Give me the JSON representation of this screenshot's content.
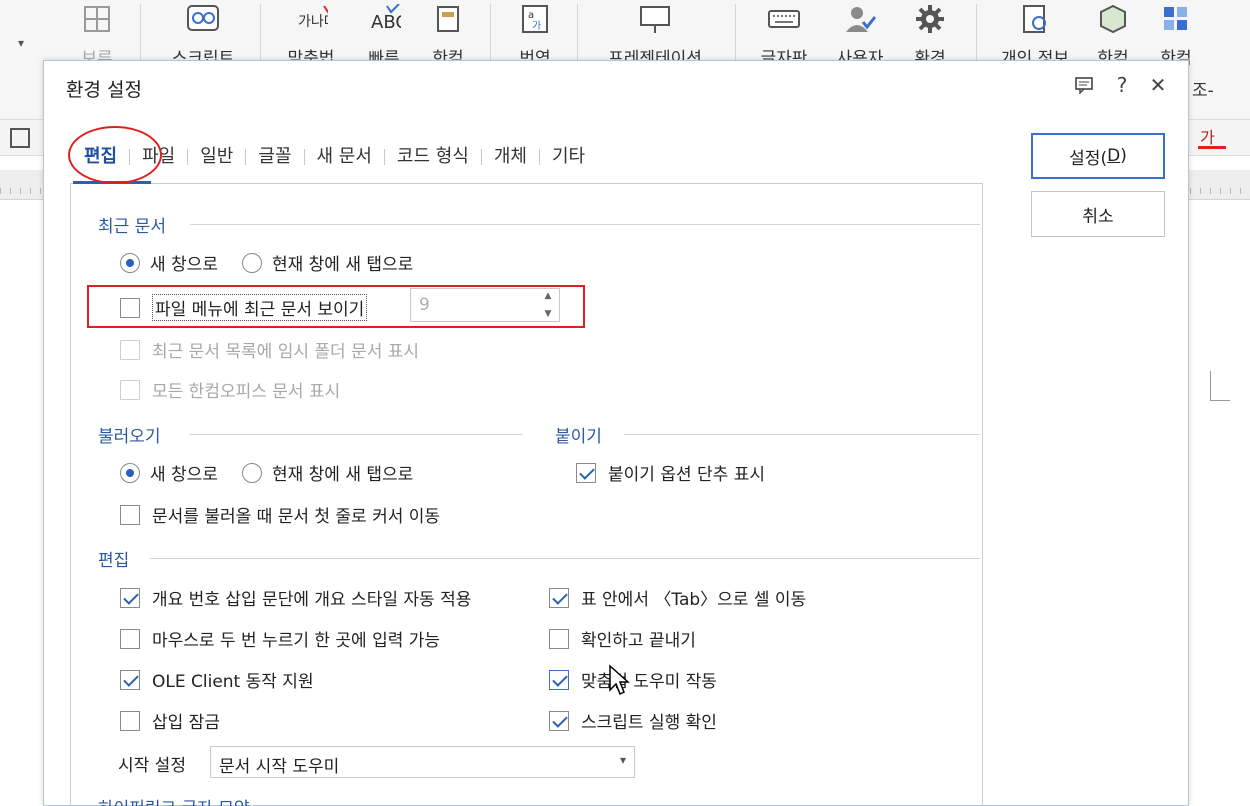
{
  "ribbon": {
    "items": [
      {
        "label": "보류",
        "icon": "table-icon"
      },
      {
        "label": "스크립트",
        "icon": "script-icon"
      },
      {
        "label": "맞춤법",
        "icon": "spellcheck-icon"
      },
      {
        "label": "빠른",
        "icon": "abc-icon"
      },
      {
        "label": "한컴",
        "icon": "dict-icon"
      },
      {
        "label": "번역",
        "icon": "translate-icon"
      },
      {
        "label": "프레젠테이션",
        "icon": "presentation-icon"
      },
      {
        "label": "글자판",
        "icon": "keyboard-icon"
      },
      {
        "label": "사용자",
        "icon": "user-icon"
      },
      {
        "label": "환경",
        "icon": "gear-icon"
      },
      {
        "label": "개인 정보",
        "icon": "privacy-icon"
      },
      {
        "label": "한컴",
        "icon": "cube-icon"
      },
      {
        "label": "한컴",
        "icon": "grid-icon"
      }
    ],
    "partial_label": "조-",
    "text_color_glyph": "가"
  },
  "dialog": {
    "title": "환경 설정",
    "tabs": [
      "편집",
      "파일",
      "일반",
      "글꼴",
      "새 문서",
      "코드 형식",
      "개체",
      "기타"
    ],
    "buttons": {
      "ok_prefix": "설정(",
      "ok_key": "D",
      "ok_suffix": ")",
      "cancel": "취소"
    }
  },
  "recent": {
    "header": "최근 문서",
    "radio_new_window": "새 창으로",
    "radio_new_tab": "현재 창에 새 탭으로",
    "show_recent_label": "파일 메뉴에 최근 문서 보이기",
    "show_recent_count": "9",
    "temp_folder_label": "최근 문서 목록에 임시 폴더 문서 표시",
    "all_docs_label": "모든 한컴오피스 문서 표시"
  },
  "load": {
    "header": "불러오기",
    "radio_new_window": "새 창으로",
    "radio_new_tab": "현재 창에 새 탭으로",
    "cursor_first_line": "문서를 불러올 때 문서 첫 줄로 커서 이동"
  },
  "paste": {
    "header": "붙이기",
    "show_options": "붙이기 옵션 단추 표시"
  },
  "edit": {
    "header": "편집",
    "outline_style": "개요 번호 삽입 문단에 개요 스타일 자동 적용",
    "tab_in_table": "표 안에서 〈Tab〉으로 셀 이동",
    "dblclick_input": "마우스로 두 번 누르기 한 곳에 입력 가능",
    "confirm_exit": "확인하고 끝내기",
    "ole_client": "OLE Client 동작 지원",
    "spell_helper": "맞춤법 도우미 작동",
    "insert_lock": "삽입 잠금",
    "script_confirm": "스크립트 실행 확인",
    "start_label": "시작 설정",
    "start_value": "문서 시작 도우미"
  },
  "cut_section": "하이퍼링크 글자 모양"
}
